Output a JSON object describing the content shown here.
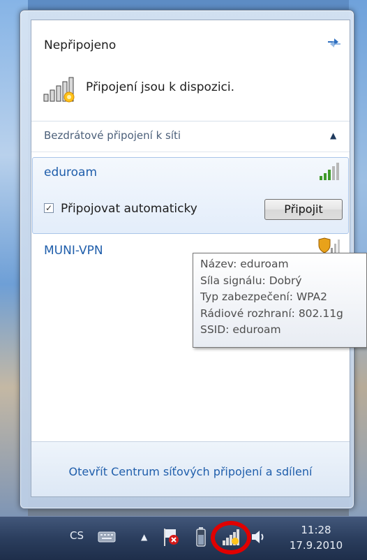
{
  "popup": {
    "status_title": "Nepřipojeno",
    "available_text": "Připojení jsou k dispozici.",
    "section_label": "Bezdrátové připojení k síti",
    "footer_link": "Otevřít Centrum síťových připojení a sdílení"
  },
  "networks": [
    {
      "name": "eduroam",
      "auto_connect_label": "Připojovat automaticky",
      "auto_connect_checked": true,
      "connect_button": "Připojit",
      "signal": "strong"
    },
    {
      "name": "MUNI-VPN",
      "signal": "weak-secured"
    }
  ],
  "tooltip": {
    "lines": [
      "Název: eduroam",
      "Síla signálu: Dobrý",
      "Typ zabezpečení: WPA2",
      "Rádiové rozhraní: 802.11g",
      "SSID: eduroam"
    ]
  },
  "taskbar": {
    "language": "CS",
    "time": "11:28",
    "date": "17.9.2010",
    "icons": [
      "keyboard-icon",
      "show-hidden-icons-arrow",
      "action-center-flag-icon",
      "battery-icon",
      "wireless-network-icon",
      "volume-icon"
    ]
  },
  "colors": {
    "link": "#1f5eab",
    "highlight_circle": "#e00000",
    "signal_green": "#3f9b2a"
  }
}
